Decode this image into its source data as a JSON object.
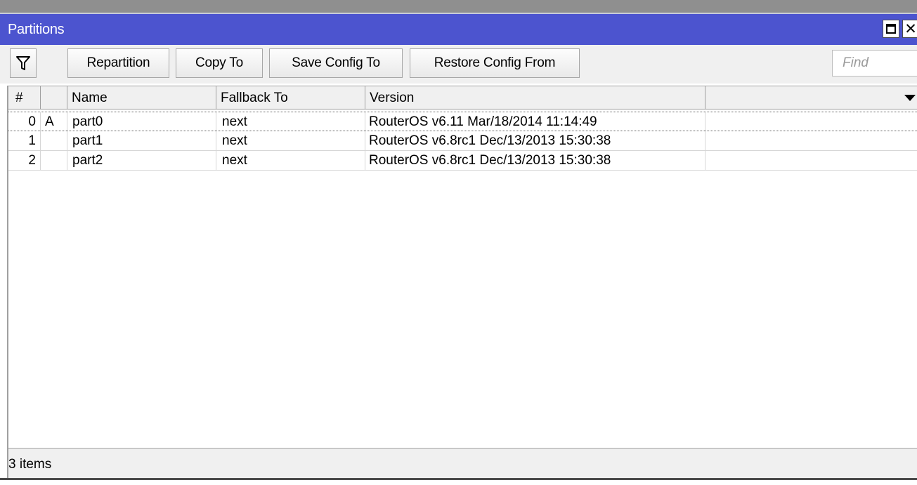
{
  "window": {
    "title": "Partitions",
    "buttons": [
      "maximize",
      "close"
    ]
  },
  "toolbar": {
    "filter_icon": "filter-icon",
    "buttons": [
      "Repartition",
      "Copy To",
      "Save Config To",
      "Restore Config From"
    ],
    "find_placeholder": "Find"
  },
  "table": {
    "columns": [
      "#",
      "",
      "Name",
      "Fallback To",
      "Version",
      ""
    ],
    "rows": [
      {
        "num": "0",
        "flag": "A",
        "name": "part0",
        "fallback": "next",
        "version": "RouterOS v6.11 Mar/18/2014 11:14:49"
      },
      {
        "num": "1",
        "flag": "",
        "name": "part1",
        "fallback": "next",
        "version": "RouterOS v6.8rc1 Dec/13/2013 15:30:38"
      },
      {
        "num": "2",
        "flag": "",
        "name": "part2",
        "fallback": "next",
        "version": "RouterOS v6.8rc1 Dec/13/2013 15:30:38"
      }
    ]
  },
  "status": {
    "items_count": "3 items"
  },
  "colors": {
    "titlebar": "#4c54cf",
    "toolbar": "#f0f0f0"
  }
}
